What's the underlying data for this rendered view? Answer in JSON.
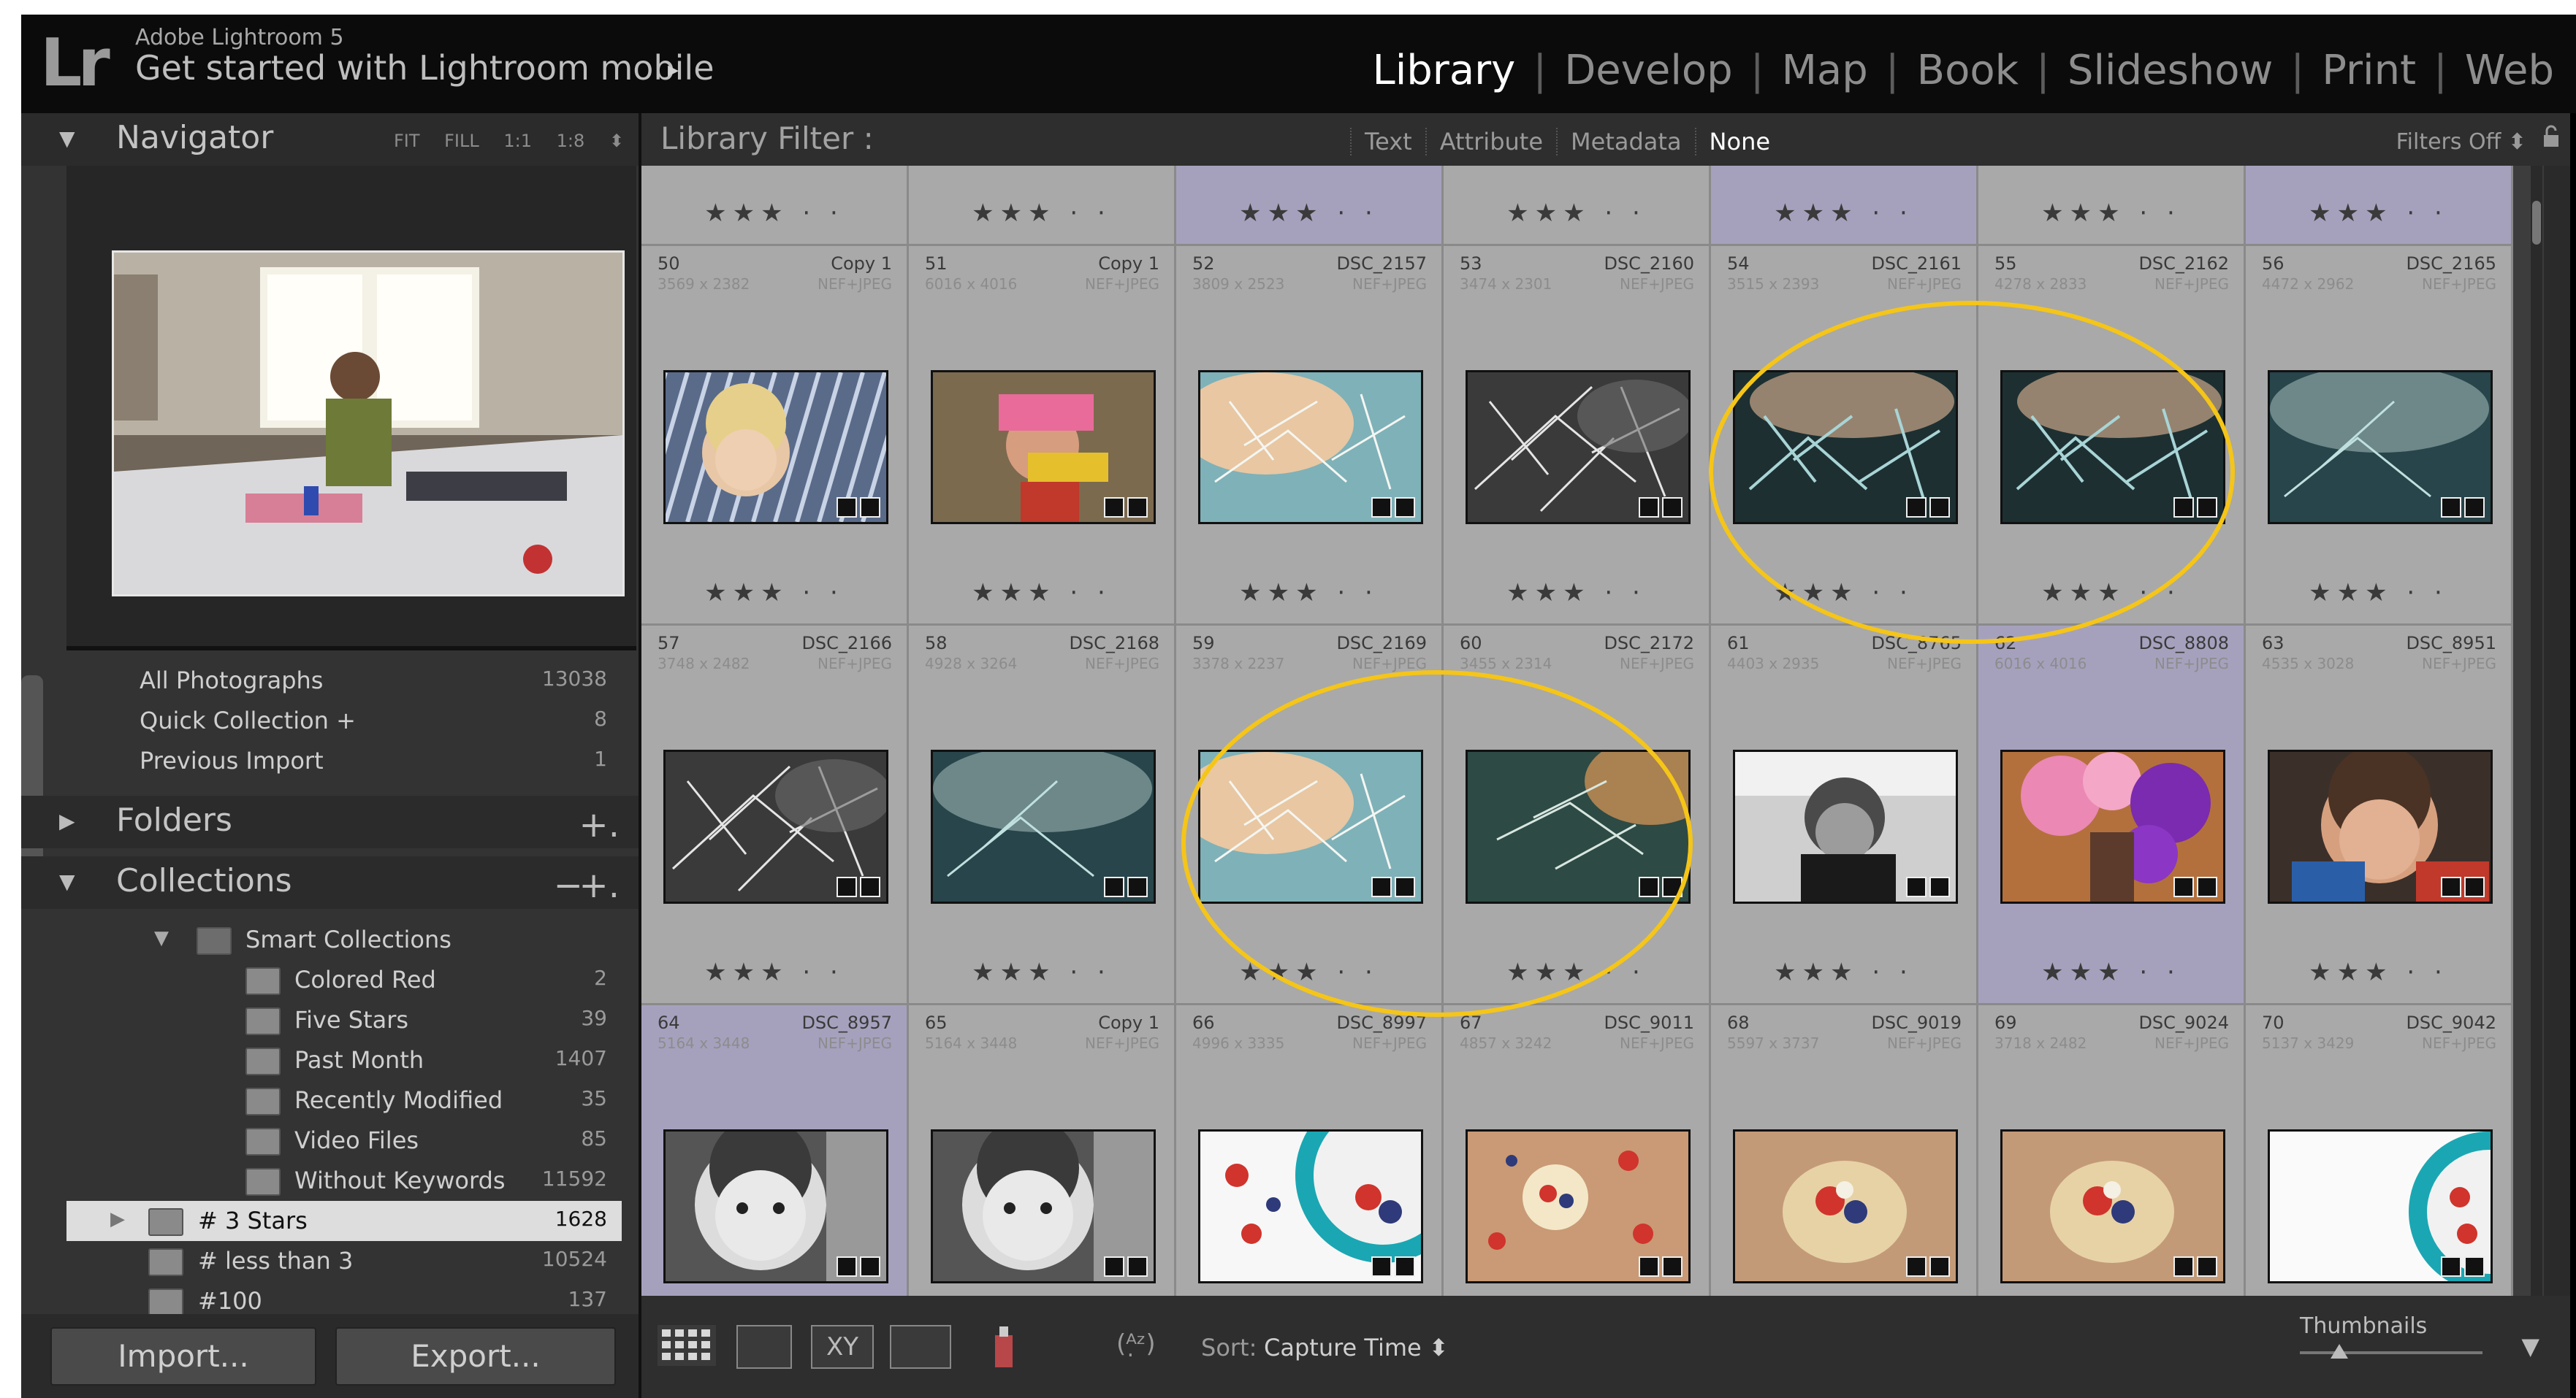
{
  "topbar": {
    "app_name": "Adobe Lightroom 5",
    "logo": "Lr",
    "promo": "Get started with Lightroom mobile",
    "promo_arrow": "▸",
    "modules": [
      "Library",
      "Develop",
      "Map",
      "Book",
      "Slideshow",
      "Print",
      "Web"
    ],
    "active_module": "Library"
  },
  "navigator": {
    "title": "Navigator",
    "zoom_options": "FIT FILL 1:1 1:8 ⬍"
  },
  "catalog": [
    {
      "label": "All Photographs",
      "count": "13038"
    },
    {
      "label": "Quick Collection +",
      "count": "8"
    },
    {
      "label": "Previous Import",
      "count": "1"
    }
  ],
  "folders": {
    "title": "Folders",
    "add": "+."
  },
  "collections": {
    "title": "Collections",
    "remove": "−",
    "add": "+.",
    "smart_group": "Smart Collections",
    "items": [
      {
        "label": "Colored Red",
        "count": "2"
      },
      {
        "label": "Five Stars",
        "count": "39"
      },
      {
        "label": "Past Month",
        "count": "1407"
      },
      {
        "label": "Recently Modified",
        "count": "35"
      },
      {
        "label": "Video Files",
        "count": "85"
      },
      {
        "label": "Without Keywords",
        "count": "11592"
      }
    ],
    "top_items": [
      {
        "label": "# 3 Stars",
        "count": "1628",
        "selected": true
      },
      {
        "label": "# less than 3",
        "count": "10524",
        "selected": false
      },
      {
        "label": "#100",
        "count": "137",
        "selected": false
      }
    ]
  },
  "left_buttons": {
    "import": "Import...",
    "export": "Export..."
  },
  "filter": {
    "title": "Library Filter :",
    "options": [
      "Text",
      "Attribute",
      "Metadata",
      "None"
    ],
    "active": "None",
    "filters_off": "Filters Off ⬍"
  },
  "grid": {
    "star_text": "★★★ · ·",
    "rows": [
      [
        {
          "num": "50",
          "name": "Copy 1",
          "dim": "3569 x 2382",
          "type": "NEF+JPEG",
          "purple": false,
          "thumb": "toddler-smiling"
        },
        {
          "num": "51",
          "name": "Copy 1",
          "dim": "6016 x 4016",
          "type": "NEF+JPEG",
          "purple": false,
          "thumb": "boy-toy"
        },
        {
          "num": "52",
          "name": "DSC_2157",
          "dim": "3809 x 2523",
          "type": "NEF+JPEG",
          "purple": false,
          "thumb": "frost-warm"
        },
        {
          "num": "53",
          "name": "DSC_2160",
          "dim": "3474 x 2301",
          "type": "NEF+JPEG",
          "purple": false,
          "thumb": "frost-bw"
        },
        {
          "num": "54",
          "name": "DSC_2161",
          "dim": "3515 x 2393",
          "type": "NEF+JPEG",
          "purple": false,
          "thumb": "frost-dark"
        },
        {
          "num": "55",
          "name": "DSC_2162",
          "dim": "4278 x 2833",
          "type": "NEF+JPEG",
          "purple": false,
          "thumb": "frost-dark"
        },
        {
          "num": "56",
          "name": "DSC_2165",
          "dim": "4472 x 2962",
          "type": "NEF+JPEG",
          "purple": false,
          "thumb": "frost-teal"
        }
      ],
      [
        {
          "num": "57",
          "name": "DSC_2166",
          "dim": "3748 x 2482",
          "type": "NEF+JPEG",
          "purple": false,
          "thumb": "frost-bw"
        },
        {
          "num": "58",
          "name": "DSC_2168",
          "dim": "4928 x 3264",
          "type": "NEF+JPEG",
          "purple": false,
          "thumb": "frost-teal"
        },
        {
          "num": "59",
          "name": "DSC_2169",
          "dim": "3378 x 2237",
          "type": "NEF+JPEG",
          "purple": false,
          "thumb": "frost-warm"
        },
        {
          "num": "60",
          "name": "DSC_2172",
          "dim": "3455 x 2314",
          "type": "NEF+JPEG",
          "purple": false,
          "thumb": "frost-green"
        },
        {
          "num": "61",
          "name": "DSC_8765",
          "dim": "4403 x 2935",
          "type": "NEF+JPEG",
          "purple": false,
          "thumb": "kid-bw"
        },
        {
          "num": "62",
          "name": "DSC_8808",
          "dim": "6016 x 4016",
          "type": "NEF+JPEG",
          "purple": true,
          "thumb": "balloons"
        },
        {
          "num": "63",
          "name": "DSC_8951",
          "dim": "4535 x 3028",
          "type": "NEF+JPEG",
          "purple": false,
          "thumb": "boy-face"
        }
      ],
      [
        {
          "num": "64",
          "name": "DSC_8957",
          "dim": "5164 x 3448",
          "type": "NEF+JPEG",
          "purple": true,
          "thumb": "boy-bw"
        },
        {
          "num": "65",
          "name": "Copy 1",
          "dim": "5164 x 3448",
          "type": "NEF+JPEG",
          "purple": false,
          "thumb": "boy-bw"
        },
        {
          "num": "66",
          "name": "DSC_8997",
          "dim": "4996 x 3335",
          "type": "NEF+JPEG",
          "purple": false,
          "thumb": "berries-bowl"
        },
        {
          "num": "67",
          "name": "DSC_9011",
          "dim": "4857 x 3242",
          "type": "NEF+JPEG",
          "purple": false,
          "thumb": "berries-table"
        },
        {
          "num": "68",
          "name": "DSC_9019",
          "dim": "5597 x 3737",
          "type": "NEF+JPEG",
          "purple": false,
          "thumb": "shortcake"
        },
        {
          "num": "69",
          "name": "DSC_9024",
          "dim": "3718 x 2482",
          "type": "NEF+JPEG",
          "purple": false,
          "thumb": "shortcake"
        },
        {
          "num": "70",
          "name": "DSC_9042",
          "dim": "5137 x 3429",
          "type": "NEF+JPEG",
          "purple": false,
          "thumb": "bowl-white"
        }
      ]
    ]
  },
  "toolbar": {
    "sort_label": "Sort:",
    "sort_value": "Capture Time ⬍",
    "thumbnails_label": "Thumbnails",
    "xy_label": "XY"
  },
  "colors": {
    "annotation": "#f5c518",
    "selected_cell": "#a5a1bd"
  }
}
